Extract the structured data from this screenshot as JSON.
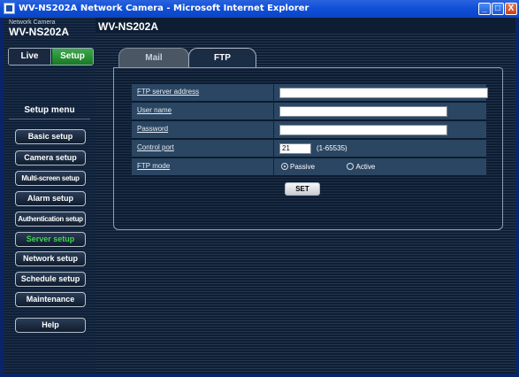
{
  "window": {
    "title": "WV-NS202A Network Camera - Microsoft Internet Explorer",
    "min_glyph": "_",
    "max_glyph": "□",
    "close_glyph": "X"
  },
  "logo": {
    "subtitle": "Network Camera",
    "model": "WV-NS202A"
  },
  "header": {
    "product_name": "WV-NS202A"
  },
  "mode": {
    "live_label": "Live",
    "setup_label": "Setup"
  },
  "setup_menu": {
    "title": "Setup menu",
    "items": [
      {
        "label": "Basic setup",
        "active": false
      },
      {
        "label": "Camera setup",
        "active": false
      },
      {
        "label": "Multi-screen setup",
        "active": false
      },
      {
        "label": "Alarm setup",
        "active": false
      },
      {
        "label": "Authentication setup",
        "active": false
      },
      {
        "label": "Server setup",
        "active": true
      },
      {
        "label": "Network setup",
        "active": false
      },
      {
        "label": "Schedule setup",
        "active": false
      },
      {
        "label": "Maintenance",
        "active": false
      }
    ],
    "help_label": "Help"
  },
  "tabs": [
    {
      "label": "Mail",
      "selected": false
    },
    {
      "label": "FTP",
      "selected": true
    }
  ],
  "ftp_form": {
    "server_address": {
      "label": "FTP server address",
      "value": ""
    },
    "user_name": {
      "label": "User name",
      "value": ""
    },
    "password": {
      "label": "Password",
      "value": ""
    },
    "control_port": {
      "label": "Control port",
      "value": "21",
      "range": "(1-65535)"
    },
    "ftp_mode": {
      "label": "FTP mode",
      "options": [
        "Passive",
        "Active"
      ],
      "selected": "Passive"
    },
    "set_label": "SET"
  }
}
